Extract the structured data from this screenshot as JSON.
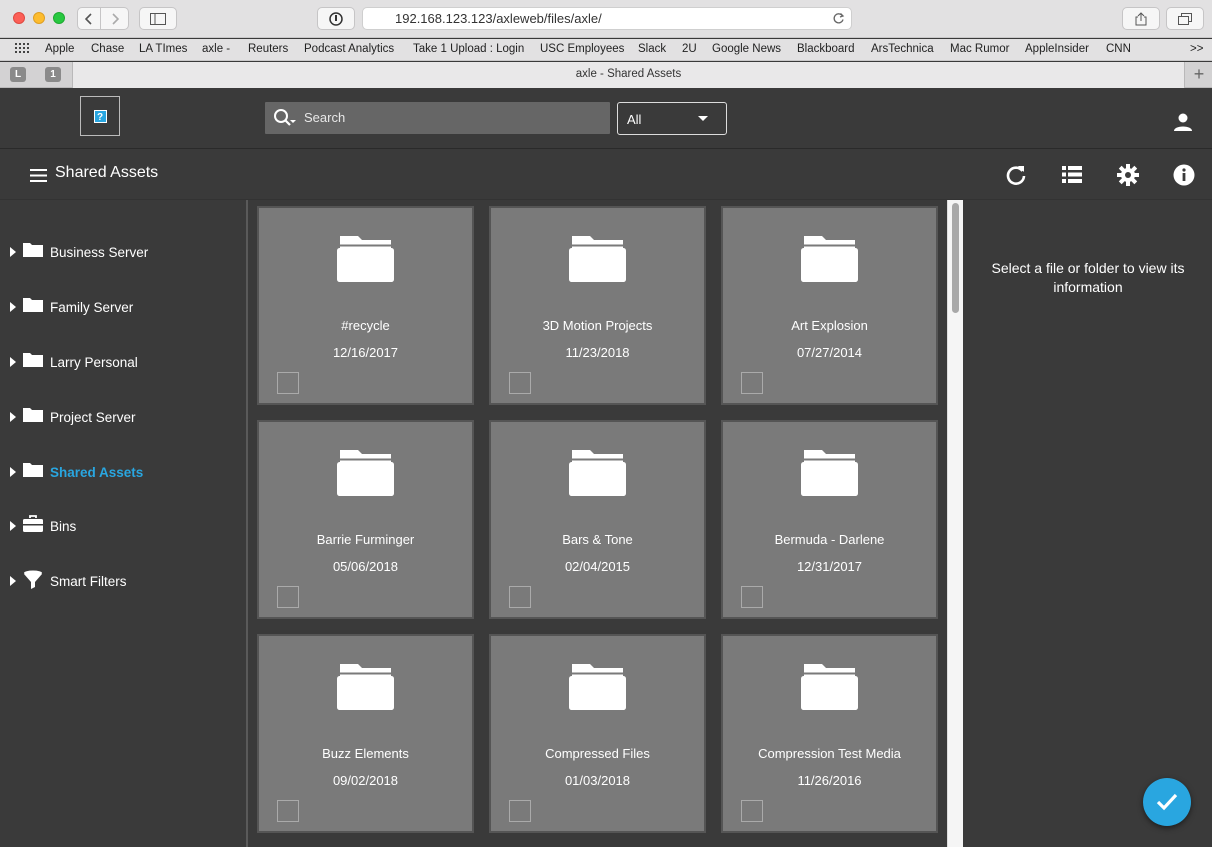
{
  "browser": {
    "url": "192.168.123.123/axleweb/files/axle/",
    "tab_title": "axle - Shared Assets",
    "pinned_tabs": [
      "L",
      "1"
    ],
    "bookmarks": [
      "Apple",
      "Chase",
      "LA TImes",
      "axle -",
      "Reuters",
      "Podcast Analytics",
      "Take 1 Upload : Login",
      "USC Employees",
      "Slack",
      "2U",
      "Google News",
      "Blackboard",
      "ArsTechnica",
      "Mac Rumor",
      "AppleInsider",
      "CNN"
    ],
    "overflow": ">>"
  },
  "header": {
    "logo_glyph": "?",
    "search_placeholder": "Search",
    "filter_value": "All"
  },
  "subheader": {
    "title": "Shared Assets"
  },
  "sidebar": {
    "items": [
      {
        "label": "Business Server",
        "icon": "folder-icon"
      },
      {
        "label": "Family Server",
        "icon": "folder-icon"
      },
      {
        "label": "Larry Personal",
        "icon": "folder-icon"
      },
      {
        "label": "Project Server",
        "icon": "folder-icon"
      },
      {
        "label": "Shared Assets",
        "icon": "folder-icon",
        "active": true
      },
      {
        "label": "Bins",
        "icon": "briefcase-icon"
      },
      {
        "label": "Smart Filters",
        "icon": "funnel-icon"
      }
    ]
  },
  "folders": [
    {
      "name": "#recycle",
      "date": "12/16/2017"
    },
    {
      "name": "3D Motion Projects",
      "date": "11/23/2018"
    },
    {
      "name": "Art Explosion",
      "date": "07/27/2014"
    },
    {
      "name": "Barrie Furminger",
      "date": "05/06/2018"
    },
    {
      "name": "Bars & Tone",
      "date": "02/04/2015"
    },
    {
      "name": "Bermuda - Darlene",
      "date": "12/31/2017"
    },
    {
      "name": "Buzz Elements",
      "date": "09/02/2018"
    },
    {
      "name": "Compressed Files",
      "date": "01/03/2018"
    },
    {
      "name": "Compression Test Media",
      "date": "11/26/2016"
    }
  ],
  "info": {
    "message": "Select a file or folder to view its information"
  },
  "colors": {
    "accent": "#29a6e0",
    "background": "#3a3a3a",
    "card": "#7a7a7a"
  }
}
